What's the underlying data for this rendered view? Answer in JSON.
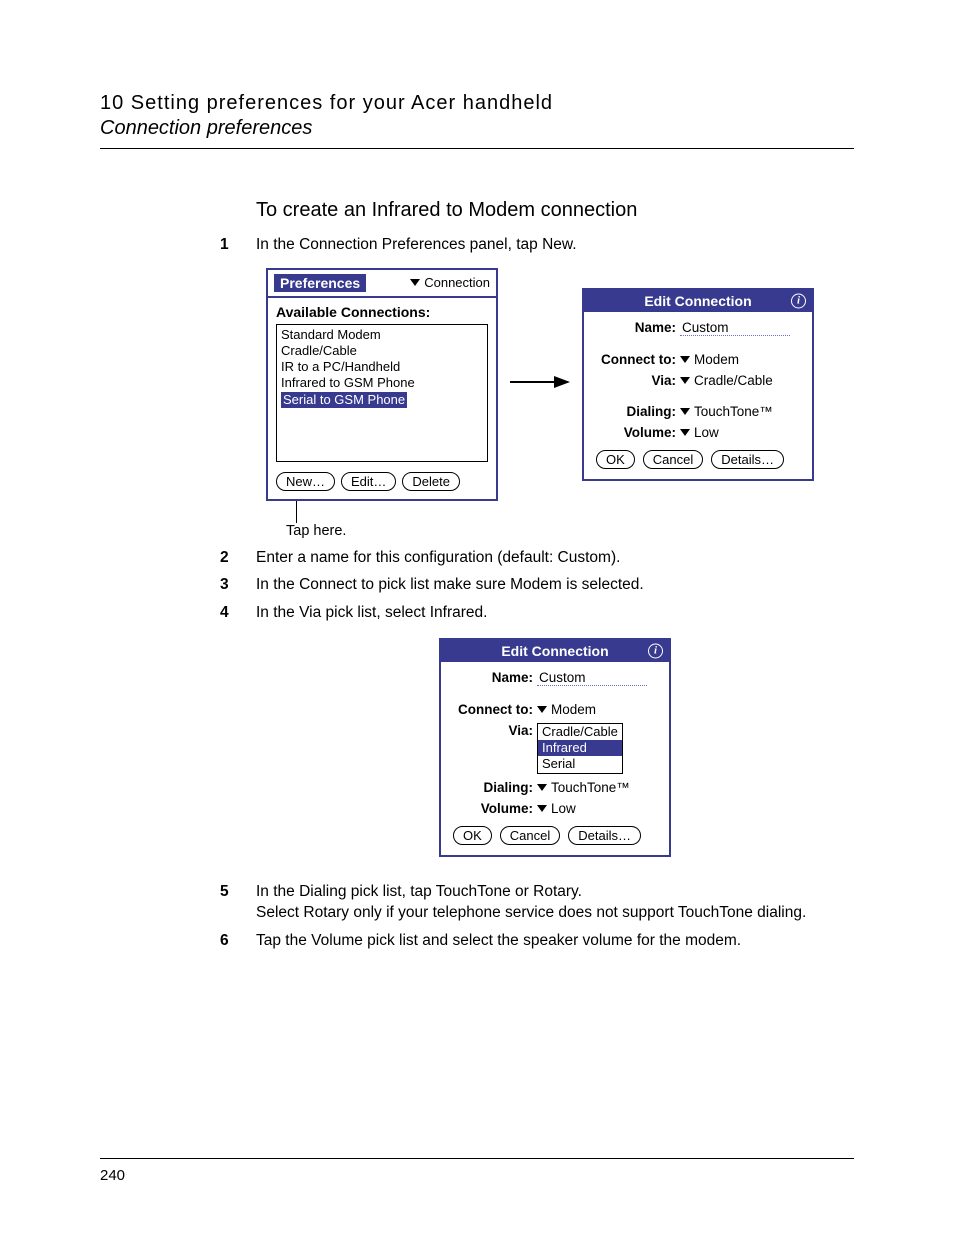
{
  "header": {
    "chapter": "10 Setting preferences for your Acer handheld",
    "subtitle": "Connection preferences"
  },
  "h3": "To create an Infrared to Modem connection",
  "steps": {
    "s1": "In the Connection Preferences panel, tap New.",
    "s2": "Enter a name for this configuration (default: Custom).",
    "s3": "In the Connect to pick list make sure Modem is selected.",
    "s4": "In the Via pick list, select Infrared.",
    "s5a": "In the Dialing pick list, tap TouchTone or Rotary.",
    "s5b": "Select Rotary only if your telephone service does not support TouchTone dialing.",
    "s6": "Tap the Volume pick list and select the speaker volume for the modem."
  },
  "annot": {
    "tapHere": "Tap here."
  },
  "palm": {
    "prefs": {
      "title": "Preferences",
      "menu": "Connection",
      "heading": "Available Connections:",
      "items": [
        "Standard Modem",
        "Cradle/Cable",
        "IR to a PC/Handheld",
        "Infrared to GSM Phone",
        "Serial to GSM Phone"
      ],
      "buttons": {
        "new": "New…",
        "edit": "Edit…",
        "del": "Delete"
      }
    },
    "edit": {
      "title": "Edit Connection",
      "nameLabel": "Name:",
      "nameValue": "Custom",
      "connectLabel": "Connect to:",
      "connectValue": "Modem",
      "viaLabel": "Via:",
      "viaValue": "Cradle/Cable",
      "viaOptions": [
        "Cradle/Cable",
        "Infrared",
        "Serial"
      ],
      "dialingLabel": "Dialing:",
      "dialingValue": "TouchTone™",
      "volumeLabel": "Volume:",
      "volumeValue": "Low",
      "buttons": {
        "ok": "OK",
        "cancel": "Cancel",
        "details": "Details…"
      }
    }
  },
  "pageNum": "240"
}
